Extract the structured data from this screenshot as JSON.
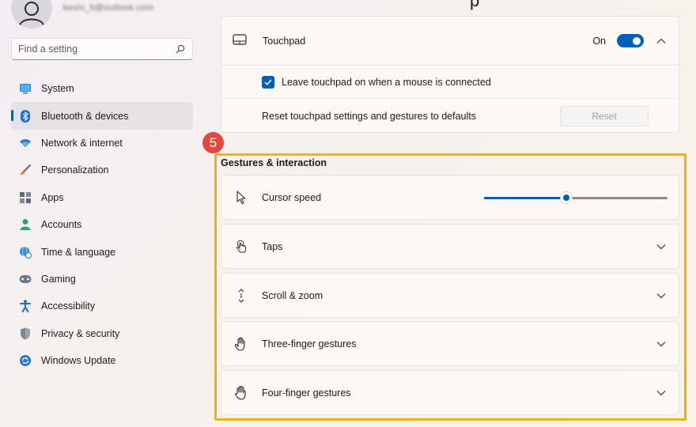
{
  "account": {
    "email": "kevin_h@outlook.com"
  },
  "search": {
    "placeholder": "Find a setting"
  },
  "sidebar": {
    "items": [
      {
        "label": "System",
        "icon": "monitor-icon"
      },
      {
        "label": "Bluetooth & devices",
        "icon": "bluetooth-icon",
        "active": true
      },
      {
        "label": "Network & internet",
        "icon": "wifi-icon"
      },
      {
        "label": "Personalization",
        "icon": "brush-icon"
      },
      {
        "label": "Apps",
        "icon": "apps-icon"
      },
      {
        "label": "Accounts",
        "icon": "person-icon"
      },
      {
        "label": "Time & language",
        "icon": "globe-clock-icon"
      },
      {
        "label": "Gaming",
        "icon": "gamepad-icon"
      },
      {
        "label": "Accessibility",
        "icon": "accessibility-icon"
      },
      {
        "label": "Privacy & security",
        "icon": "shield-icon"
      },
      {
        "label": "Windows Update",
        "icon": "update-icon"
      }
    ]
  },
  "touchpad": {
    "title": "Touchpad",
    "toggle_state": "On",
    "leave_on_label": "Leave touchpad on when a mouse is connected",
    "reset_label": "Reset touchpad settings and gestures to defaults",
    "reset_button": "Reset"
  },
  "annotation": {
    "badge": "5",
    "highlight_color": "#f0b400"
  },
  "gestures": {
    "title": "Gestures & interaction",
    "cursor_speed": {
      "label": "Cursor speed",
      "value_fraction": 0.45
    },
    "rows": [
      {
        "label": "Taps",
        "icon": "tap-icon"
      },
      {
        "label": "Scroll & zoom",
        "icon": "scroll-icon"
      },
      {
        "label": "Three-finger gestures",
        "icon": "hand-three-icon"
      },
      {
        "label": "Four-finger gestures",
        "icon": "hand-four-icon"
      }
    ]
  },
  "colors": {
    "accent": "#005fb8",
    "badge": "#e8453c"
  }
}
